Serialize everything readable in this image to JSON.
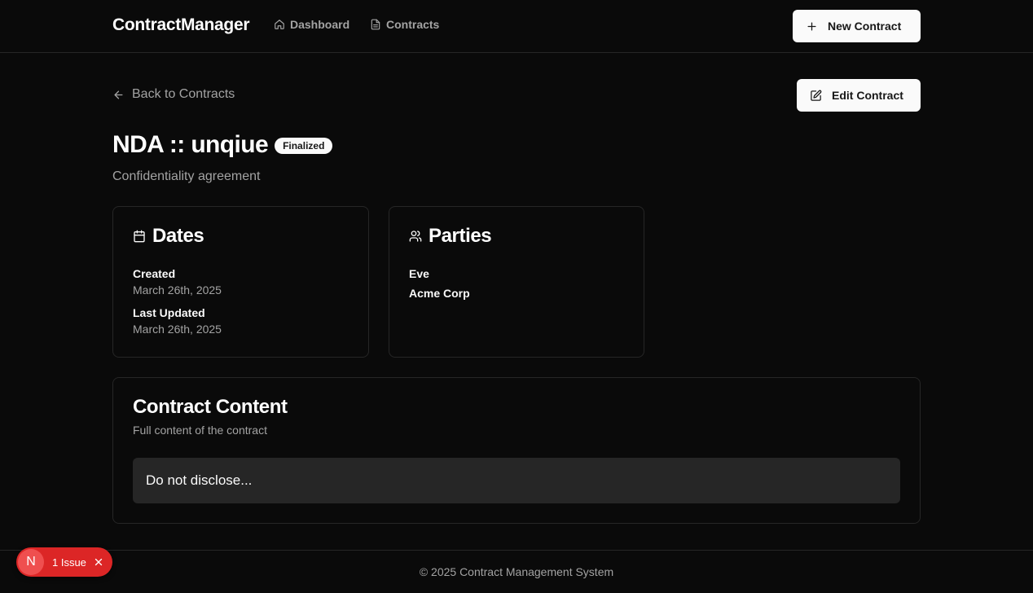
{
  "header": {
    "brand": "ContractManager",
    "nav": [
      {
        "label": "Dashboard",
        "icon": "home-icon"
      },
      {
        "label": "Contracts",
        "icon": "file-text-icon"
      }
    ],
    "new_contract_label": "New Contract"
  },
  "page": {
    "back_label": "Back to Contracts",
    "edit_label": "Edit Contract",
    "title": "NDA :: unqiue",
    "status": "Finalized",
    "description": "Confidentiality agreement"
  },
  "dates_card": {
    "title": "Dates",
    "created_label": "Created",
    "created_value": "March 26th, 2025",
    "updated_label": "Last Updated",
    "updated_value": "March 26th, 2025"
  },
  "parties_card": {
    "title": "Parties",
    "parties": [
      "Eve",
      "Acme Corp"
    ]
  },
  "content_card": {
    "title": "Contract Content",
    "subtitle": "Full content of the contract",
    "body": "Do not disclose..."
  },
  "footer": {
    "text": "© 2025 Contract Management System"
  },
  "dev_overlay": {
    "logo": "N",
    "issues_label": "1 Issue"
  },
  "colors": {
    "background": "#0a0a0a",
    "border": "#262626",
    "muted_text": "#a3a3a3",
    "button_bg": "#fafafa",
    "issue_red": "#dc2626"
  }
}
